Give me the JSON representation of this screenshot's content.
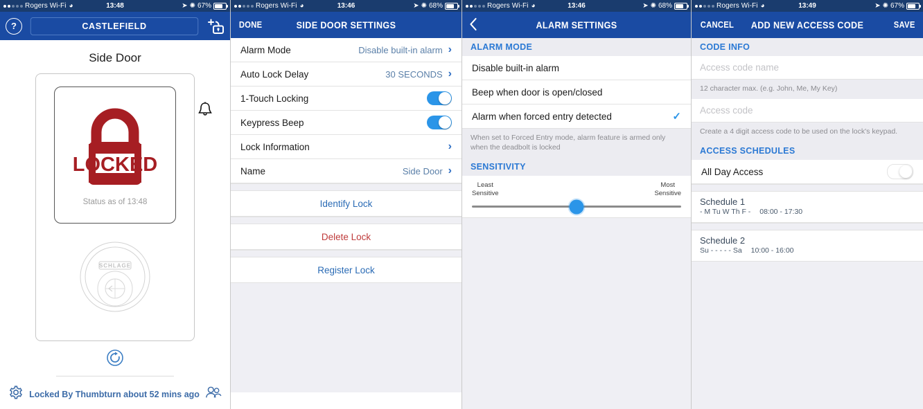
{
  "status_bar": {
    "carrier": "Rogers Wi-Fi",
    "wifi_icon": "wifi-icon",
    "panel1": {
      "time": "13:48",
      "battery": "67%"
    },
    "panel2": {
      "time": "13:46",
      "battery": "68%"
    },
    "panel3": {
      "time": "13:46",
      "battery": "68%"
    },
    "panel4": {
      "time": "13:49",
      "battery": "67%"
    }
  },
  "panel1": {
    "help_label": "?",
    "home_name": "CASTLEFIELD",
    "add_lock_icon": "add-lock-icon",
    "door_title": "Side Door",
    "lock_state": "LOCKED",
    "status_as_of": "Status as of 13:48",
    "bell_icon": "bell-icon",
    "brand": "SCHLAGE",
    "refresh_icon": "refresh-icon",
    "settings_icon": "gear-icon",
    "users_icon": "users-icon",
    "footer_text": "Locked By Thumbturn about 52 mins ago"
  },
  "panel2": {
    "nav": {
      "left": "DONE",
      "title": "SIDE DOOR SETTINGS"
    },
    "rows": [
      {
        "label": "Alarm Mode",
        "value": "Disable built-in alarm",
        "type": "chevron"
      },
      {
        "label": "Auto Lock Delay",
        "value": "30 SECONDS",
        "type": "chevron"
      },
      {
        "label": "1-Touch Locking",
        "value": "on",
        "type": "toggle"
      },
      {
        "label": "Keypress Beep",
        "value": "on",
        "type": "toggle"
      },
      {
        "label": "Lock Information",
        "value": "",
        "type": "chevron"
      },
      {
        "label": "Name",
        "value": "Side Door",
        "type": "chevron"
      }
    ],
    "actions": [
      {
        "label": "Identify Lock",
        "style": "blue"
      },
      {
        "label": "Delete Lock",
        "style": "red"
      },
      {
        "label": "Register Lock",
        "style": "blue"
      }
    ]
  },
  "panel3": {
    "nav": {
      "back_icon": "back-chevron-icon",
      "title": "ALARM SETTINGS"
    },
    "section_alarm_mode": "ALARM MODE",
    "options": [
      {
        "label": "Disable built-in alarm",
        "selected": false
      },
      {
        "label": "Beep when door is open/closed",
        "selected": false
      },
      {
        "label": "Alarm when forced entry detected",
        "selected": true
      }
    ],
    "note": "When set to Forced Entry mode, alarm feature is armed only when the deadbolt is locked",
    "section_sensitivity": "SENSITIVITY",
    "slider": {
      "min_label_line1": "Least",
      "min_label_line2": "Sensitive",
      "max_label_line1": "Most",
      "max_label_line2": "Sensitive",
      "value_percent": 50
    }
  },
  "panel4": {
    "nav": {
      "left": "CANCEL",
      "title": "ADD NEW ACCESS CODE",
      "right": "SAVE"
    },
    "section_code_info": "CODE INFO",
    "name_placeholder": "Access code name",
    "name_hint": "12 character max. (e.g. John, Me, My Key)",
    "code_placeholder": "Access code",
    "code_hint": "Create a 4 digit access code to be used on the lock's keypad.",
    "section_access_schedules": "ACCESS SCHEDULES",
    "all_day_access_label": "All Day Access",
    "all_day_access_state": "off",
    "schedules": [
      {
        "name": "Schedule 1",
        "days": "- M Tu W Th F -",
        "time": "08:00 - 17:30"
      },
      {
        "name": "Schedule 2",
        "days": "Su - - - - - Sa",
        "time": "10:00 - 16:00"
      }
    ]
  },
  "colors": {
    "nav_blue": "#1a4ba3",
    "status_blue": "#1a3c6e",
    "toggle_on": "#2b95e8",
    "section_header_blue": "#2b79d4",
    "lock_red": "#a61e23",
    "delete_red": "#bf3b3b",
    "link_blue": "#2a6bb5"
  }
}
